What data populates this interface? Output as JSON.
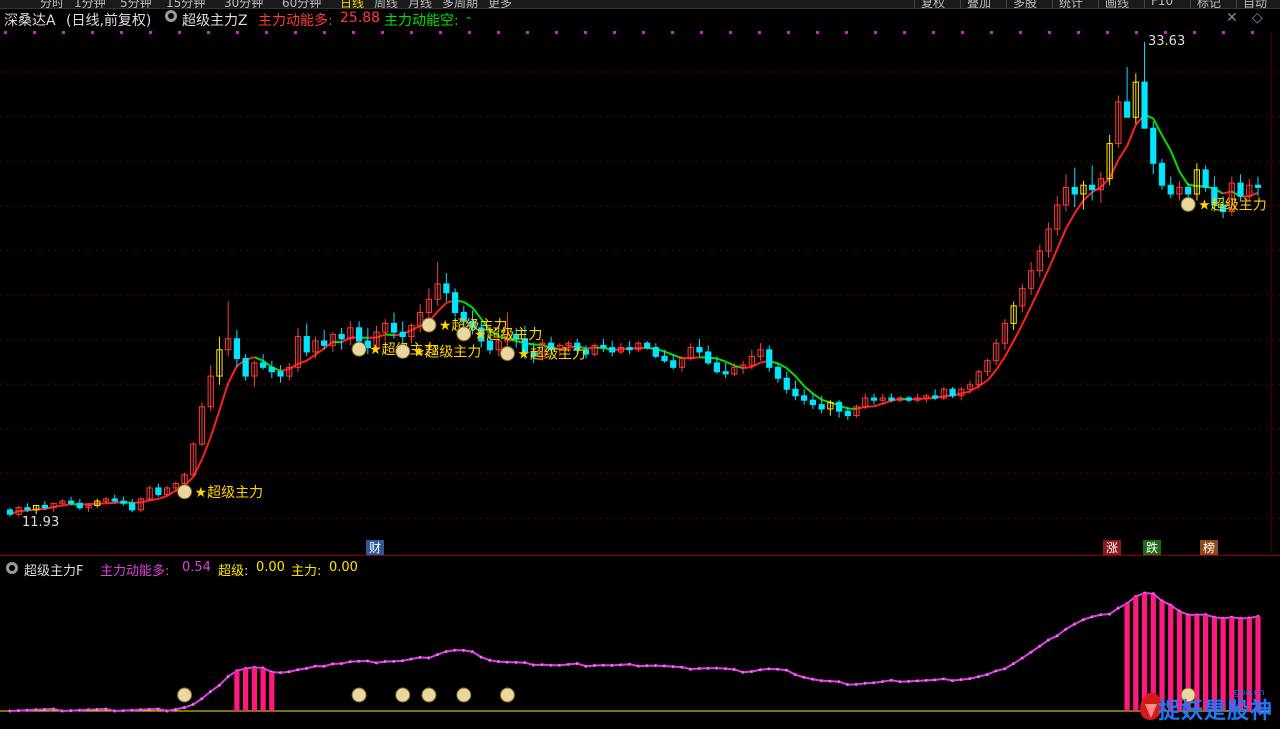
{
  "toolbar": {
    "periods": [
      {
        "label": "分时",
        "active": false
      },
      {
        "label": "1分钟",
        "active": false
      },
      {
        "label": "5分钟",
        "active": false
      },
      {
        "label": "15分钟",
        "active": false
      },
      {
        "label": "30分钟",
        "active": false
      },
      {
        "label": "60分钟",
        "active": false
      },
      {
        "label": "日线",
        "active": true
      },
      {
        "label": "周线",
        "active": false
      },
      {
        "label": "月线",
        "active": false
      },
      {
        "label": "多周期",
        "active": false
      },
      {
        "label": "更多",
        "active": false
      }
    ],
    "tools": [
      "复权",
      "叠加",
      "多股",
      "统计",
      "画线",
      "F10",
      "标记",
      "自动"
    ]
  },
  "main_panel": {
    "stock_name": "深桑达A",
    "period_info": "(日线,前复权)",
    "indicator_name": "超级主力Z",
    "line_long_label": "主力动能多:",
    "line_long_value": "25.88",
    "line_short_label": "主力动能空:",
    "line_short_value": "-",
    "high_price": "33.63",
    "low_price": "11.93",
    "signal_text": "超级主力",
    "colors": {
      "up": "#ff3b3b",
      "down": "#00e5ff",
      "yellow": "#ffe600",
      "long": "#ff2020",
      "short": "#00e000",
      "signal": "#ffd400"
    }
  },
  "events": [
    {
      "label": "财",
      "color": "#2a5a9a"
    },
    {
      "label": "涨",
      "color": "#8b1a1a"
    },
    {
      "label": "跌",
      "color": "#1a6a1a"
    },
    {
      "label": "榜",
      "color": "#8b4a1a"
    }
  ],
  "sub_panel": {
    "indicator_name": "超级主力F",
    "f1_label": "主力动能多:",
    "f1_value": "0.54",
    "f2_label": "超级:",
    "f2_value": "0.00",
    "f3_label": "主力:",
    "f3_value": "0.00",
    "colors": {
      "curve": "#e040e0",
      "bars": "#ff1a80",
      "baseline": "#ffe600"
    }
  },
  "watermark": {
    "text": "捉妖是股神",
    "small": "gpa.cn"
  },
  "chart_data": {
    "type": "candlestick",
    "y_range": [
      11.93,
      33.63
    ],
    "candles": [
      [
        12.3,
        12.4,
        12.0,
        12.1
      ],
      [
        12.1,
        12.5,
        12.0,
        12.4
      ],
      [
        12.4,
        12.6,
        12.2,
        12.3
      ],
      [
        12.3,
        12.5,
        12.1,
        12.5
      ],
      [
        12.5,
        12.7,
        12.3,
        12.4
      ],
      [
        12.4,
        12.6,
        12.2,
        12.6
      ],
      [
        12.6,
        12.8,
        12.5,
        12.7
      ],
      [
        12.7,
        12.9,
        12.5,
        12.6
      ],
      [
        12.6,
        12.8,
        12.3,
        12.4
      ],
      [
        12.4,
        12.6,
        12.2,
        12.5
      ],
      [
        12.5,
        12.8,
        12.4,
        12.7
      ],
      [
        12.7,
        12.9,
        12.6,
        12.8
      ],
      [
        12.8,
        13.0,
        12.6,
        12.7
      ],
      [
        12.7,
        12.9,
        12.5,
        12.6
      ],
      [
        12.6,
        12.8,
        12.2,
        12.3
      ],
      [
        12.3,
        12.9,
        12.2,
        12.8
      ],
      [
        12.8,
        13.4,
        12.7,
        13.3
      ],
      [
        13.3,
        13.5,
        12.9,
        13.0
      ],
      [
        13.0,
        13.4,
        12.9,
        13.3
      ],
      [
        13.3,
        13.6,
        13.1,
        13.5
      ],
      [
        13.5,
        14.0,
        13.4,
        13.9
      ],
      [
        13.9,
        15.4,
        13.8,
        15.3
      ],
      [
        15.3,
        17.2,
        15.2,
        17.0
      ],
      [
        17.0,
        18.9,
        16.8,
        18.4
      ],
      [
        18.4,
        20.2,
        18.0,
        19.6
      ],
      [
        19.6,
        21.8,
        19.3,
        20.1
      ],
      [
        20.1,
        20.5,
        18.8,
        19.2
      ],
      [
        19.2,
        19.4,
        18.2,
        18.4
      ],
      [
        18.4,
        19.1,
        17.9,
        19.0
      ],
      [
        19.0,
        19.4,
        18.7,
        18.8
      ],
      [
        18.8,
        19.1,
        18.3,
        18.6
      ],
      [
        18.6,
        18.9,
        18.1,
        18.4
      ],
      [
        18.4,
        19.0,
        18.2,
        18.8
      ],
      [
        18.8,
        20.6,
        18.6,
        20.2
      ],
      [
        20.2,
        20.8,
        19.3,
        19.5
      ],
      [
        19.5,
        20.2,
        19.2,
        20.0
      ],
      [
        20.0,
        20.5,
        19.6,
        19.8
      ],
      [
        19.8,
        20.4,
        19.5,
        20.3
      ],
      [
        20.3,
        20.6,
        19.6,
        20.1
      ],
      [
        20.1,
        20.9,
        19.8,
        20.6
      ],
      [
        20.6,
        20.9,
        19.9,
        20.0
      ],
      [
        20.0,
        20.6,
        19.4,
        19.7
      ],
      [
        19.7,
        20.7,
        19.5,
        20.4
      ],
      [
        20.4,
        21.0,
        20.0,
        20.8
      ],
      [
        20.8,
        21.3,
        20.1,
        20.4
      ],
      [
        20.4,
        20.9,
        19.8,
        20.2
      ],
      [
        20.2,
        20.8,
        19.9,
        20.7
      ],
      [
        20.7,
        21.7,
        20.4,
        21.3
      ],
      [
        21.3,
        22.4,
        21.0,
        21.9
      ],
      [
        21.9,
        23.6,
        21.6,
        22.6
      ],
      [
        22.6,
        23.1,
        21.8,
        22.2
      ],
      [
        22.2,
        22.4,
        21.1,
        21.3
      ],
      [
        21.3,
        21.6,
        20.6,
        20.9
      ],
      [
        20.9,
        21.4,
        20.3,
        20.6
      ],
      [
        20.6,
        20.9,
        19.7,
        20.0
      ],
      [
        20.0,
        20.6,
        19.4,
        19.6
      ],
      [
        19.6,
        20.2,
        19.3,
        20.0
      ],
      [
        20.0,
        21.3,
        19.7,
        20.3
      ],
      [
        20.3,
        20.6,
        19.7,
        20.1
      ],
      [
        20.1,
        20.7,
        19.2,
        19.5
      ],
      [
        19.5,
        19.9,
        19.0,
        19.3
      ],
      [
        19.3,
        20.1,
        19.1,
        19.9
      ],
      [
        19.9,
        20.2,
        19.5,
        19.6
      ],
      [
        19.6,
        19.9,
        19.3,
        19.8
      ],
      [
        19.8,
        20.0,
        19.5,
        19.9
      ],
      [
        19.9,
        20.1,
        19.4,
        19.6
      ],
      [
        19.6,
        19.8,
        19.2,
        19.4
      ],
      [
        19.4,
        19.9,
        19.3,
        19.8
      ],
      [
        19.8,
        20.1,
        19.5,
        19.7
      ],
      [
        19.7,
        20.0,
        19.3,
        19.5
      ],
      [
        19.5,
        19.9,
        19.4,
        19.7
      ],
      [
        19.7,
        20.0,
        19.4,
        19.6
      ],
      [
        19.6,
        20.0,
        19.5,
        19.9
      ],
      [
        19.9,
        20.0,
        19.6,
        19.7
      ],
      [
        19.7,
        19.9,
        19.2,
        19.3
      ],
      [
        19.3,
        19.6,
        19.0,
        19.1
      ],
      [
        19.1,
        19.4,
        18.7,
        18.8
      ],
      [
        18.8,
        19.3,
        18.6,
        19.2
      ],
      [
        19.2,
        19.9,
        19.1,
        19.7
      ],
      [
        19.7,
        20.1,
        19.3,
        19.5
      ],
      [
        19.5,
        19.8,
        18.9,
        19.0
      ],
      [
        19.0,
        19.3,
        18.5,
        18.6
      ],
      [
        18.6,
        19.0,
        18.3,
        18.5
      ],
      [
        18.5,
        19.0,
        18.4,
        18.8
      ],
      [
        18.8,
        19.1,
        18.5,
        18.9
      ],
      [
        18.9,
        19.6,
        18.7,
        19.3
      ],
      [
        19.3,
        19.9,
        19.1,
        19.6
      ],
      [
        19.6,
        19.8,
        18.6,
        18.8
      ],
      [
        18.8,
        19.0,
        18.1,
        18.3
      ],
      [
        18.3,
        18.6,
        17.6,
        17.8
      ],
      [
        17.8,
        18.2,
        17.3,
        17.5
      ],
      [
        17.5,
        17.8,
        17.1,
        17.3
      ],
      [
        17.3,
        17.6,
        16.9,
        17.1
      ],
      [
        17.1,
        17.5,
        16.7,
        16.9
      ],
      [
        16.9,
        17.3,
        16.6,
        17.2
      ],
      [
        17.2,
        17.3,
        16.5,
        16.8
      ],
      [
        16.8,
        17.0,
        16.4,
        16.6
      ],
      [
        16.6,
        17.1,
        16.5,
        17.0
      ],
      [
        17.0,
        17.6,
        16.9,
        17.4
      ],
      [
        17.4,
        17.6,
        17.1,
        17.3
      ],
      [
        17.3,
        17.6,
        17.1,
        17.4
      ],
      [
        17.4,
        17.6,
        17.2,
        17.3
      ],
      [
        17.3,
        17.5,
        17.2,
        17.4
      ],
      [
        17.4,
        17.5,
        17.2,
        17.3
      ],
      [
        17.3,
        17.6,
        17.2,
        17.4
      ],
      [
        17.4,
        17.6,
        17.2,
        17.5
      ],
      [
        17.5,
        17.8,
        17.3,
        17.4
      ],
      [
        17.4,
        17.9,
        17.3,
        17.8
      ],
      [
        17.8,
        17.9,
        17.4,
        17.5
      ],
      [
        17.5,
        17.9,
        17.3,
        17.8
      ],
      [
        17.8,
        18.2,
        17.6,
        18.0
      ],
      [
        18.0,
        18.7,
        17.8,
        18.6
      ],
      [
        18.6,
        19.2,
        18.4,
        19.1
      ],
      [
        19.1,
        20.1,
        18.9,
        19.9
      ],
      [
        19.9,
        21.0,
        19.6,
        20.8
      ],
      [
        20.8,
        21.8,
        20.5,
        21.6
      ],
      [
        21.6,
        22.6,
        21.3,
        22.4
      ],
      [
        22.4,
        23.6,
        22.1,
        23.2
      ],
      [
        23.2,
        24.4,
        22.9,
        24.1
      ],
      [
        24.1,
        25.4,
        23.8,
        25.1
      ],
      [
        25.1,
        26.6,
        24.8,
        26.2
      ],
      [
        26.2,
        27.6,
        25.9,
        27.0
      ],
      [
        27.0,
        27.9,
        26.1,
        26.7
      ],
      [
        26.7,
        27.3,
        26.0,
        27.1
      ],
      [
        27.1,
        28.0,
        26.4,
        26.9
      ],
      [
        26.9,
        27.7,
        26.3,
        27.4
      ],
      [
        27.4,
        29.4,
        27.1,
        29.0
      ],
      [
        29.0,
        31.2,
        28.8,
        30.9
      ],
      [
        30.9,
        32.5,
        30.4,
        30.2
      ],
      [
        30.2,
        32.2,
        29.9,
        31.8
      ],
      [
        31.8,
        33.63,
        31.2,
        29.7
      ],
      [
        29.7,
        30.0,
        27.6,
        28.1
      ],
      [
        28.1,
        28.3,
        26.9,
        27.1
      ],
      [
        27.1,
        27.5,
        26.5,
        26.7
      ],
      [
        26.7,
        27.3,
        26.4,
        27.0
      ],
      [
        27.0,
        27.2,
        26.5,
        26.7
      ],
      [
        26.7,
        28.1,
        26.4,
        27.8
      ],
      [
        27.8,
        28.0,
        26.8,
        27.0
      ],
      [
        27.0,
        27.5,
        25.9,
        26.2
      ],
      [
        26.2,
        26.6,
        25.6,
        25.9
      ],
      [
        25.9,
        27.5,
        25.7,
        27.2
      ],
      [
        27.2,
        27.6,
        26.4,
        26.6
      ],
      [
        26.6,
        27.4,
        26.4,
        27.1
      ],
      [
        27.1,
        27.5,
        26.6,
        27.0
      ]
    ]
  }
}
